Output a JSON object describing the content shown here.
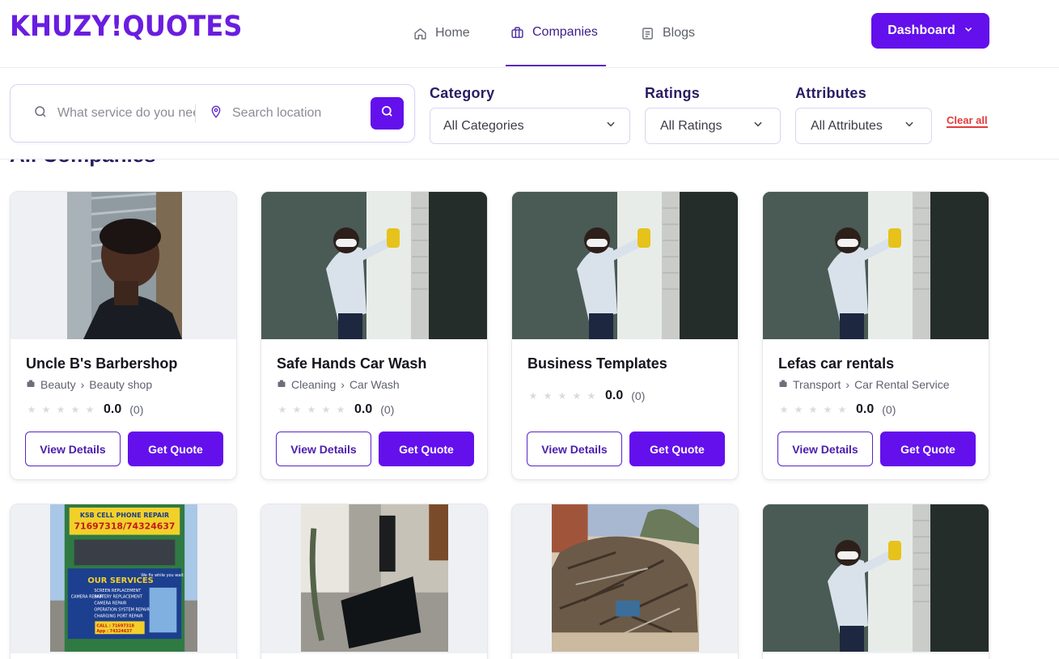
{
  "brand": {
    "logo_text": "KHUZY!QUOTES",
    "accent": "#6310ec"
  },
  "nav": {
    "items": [
      {
        "label": "Home",
        "icon": "home-icon"
      },
      {
        "label": "Companies",
        "icon": "briefcase-icon",
        "active": true
      },
      {
        "label": "Blogs",
        "icon": "document-icon"
      }
    ],
    "dashboard_label": "Dashboard"
  },
  "search": {
    "service_placeholder": "What service do you need?",
    "location_placeholder": "Search location"
  },
  "filters": {
    "category": {
      "label": "Category",
      "value": "All Categories"
    },
    "ratings": {
      "label": "Ratings",
      "value": "All Ratings"
    },
    "attributes": {
      "label": "Attributes",
      "value": "All Attributes"
    },
    "clear_all": "Clear all"
  },
  "section_title": "All Companies",
  "card_buttons": {
    "view": "View Details",
    "quote": "Get Quote"
  },
  "companies": [
    {
      "name": "Uncle B's Barbershop",
      "category": "Beauty",
      "subcategory": "Beauty shop",
      "rating": "0.0",
      "count": "(0)"
    },
    {
      "name": "Safe Hands Car Wash",
      "category": "Cleaning",
      "subcategory": "Car Wash",
      "rating": "0.0",
      "count": "(0)"
    },
    {
      "name": "Business Templates",
      "rating": "0.0",
      "count": "(0)"
    },
    {
      "name": "Lefas car rentals",
      "category": "Transport",
      "subcategory": "Car Rental Service",
      "rating": "0.0",
      "count": "(0)"
    }
  ],
  "sign_text": {
    "shop": "KSB CELL PHONE REPAIR",
    "phones": "71697318/74324637",
    "services_title": "OUR SERVICES",
    "slogan": "We fix while you wait",
    "services": [
      "SCREEN REPLACEMENT",
      "CAMERA REPAIR",
      "BATTERY REPLACEMENT",
      "CAMERA REPAIR",
      "OPERATION SYSTEM REPAIR",
      "CHARGING PORT REPAIR"
    ],
    "call": "CALL : 71697318",
    "app": "App : 74324637"
  }
}
